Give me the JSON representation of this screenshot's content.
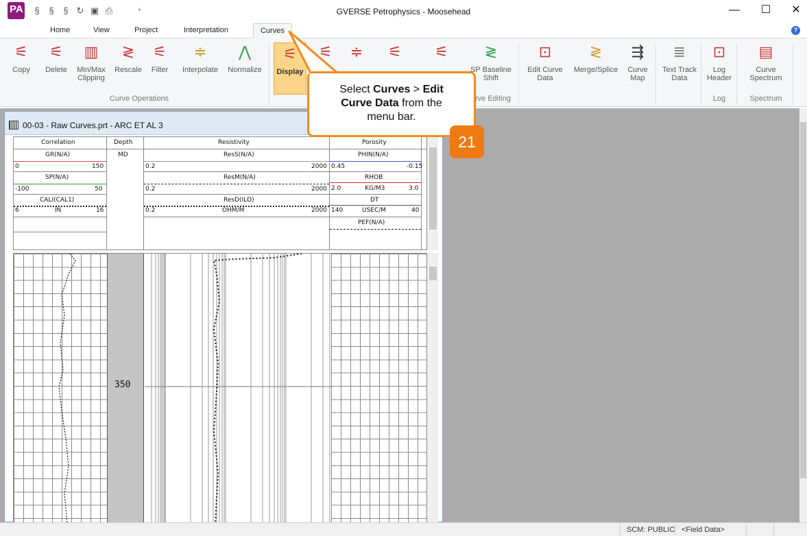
{
  "window": {
    "title": "GVERSE Petrophysics - Moosehead",
    "logo_text": "PA",
    "minimize": "—",
    "maximize": "☐",
    "close": "✕"
  },
  "quick_access": {
    "icons": [
      "curve-tool-icon",
      "curve-tool-icon",
      "curve-tool-icon",
      "refresh-icon",
      "save-icon",
      "print-icon"
    ],
    "dropdown": "⍖"
  },
  "tabs": [
    {
      "label": "Home"
    },
    {
      "label": "View"
    },
    {
      "label": "Project"
    },
    {
      "label": "Interpretation"
    },
    {
      "label": "Curves",
      "active": true
    }
  ],
  "ribbon": {
    "buttons": [
      {
        "label": "Copy",
        "icon": "copy-curve-icon"
      },
      {
        "label": "Delete",
        "icon": "delete-curve-icon"
      },
      {
        "label": "Min/Max Clipping",
        "label1": "Min/Max",
        "label2": "Clipping",
        "icon": "clipping-icon"
      },
      {
        "label": "Rescale",
        "icon": "rescale-icon"
      },
      {
        "label": "Filter",
        "icon": "filter-icon"
      },
      {
        "label": "Interpolate",
        "icon": "interpolate-icon"
      },
      {
        "label": "Normalize",
        "icon": "normalize-icon"
      },
      {
        "label": "Display",
        "icon": "display-icon",
        "active": true
      },
      {
        "label": "SP Baseline Shift",
        "label1": "SP Baseline",
        "label2": "Shift",
        "icon": "sp-baseline-icon"
      },
      {
        "label": "Edit Curve Data",
        "label1": "Edit Curve",
        "label2": "Data",
        "icon": "edit-curve-icon"
      },
      {
        "label": "Merge/Splice",
        "icon": "merge-splice-icon"
      },
      {
        "label": "Curve Map",
        "label1": "Curve",
        "label2": "Map",
        "icon": "curve-map-icon"
      },
      {
        "label": "Text Track Data",
        "label1": "Text Track",
        "label2": "Data",
        "icon": "text-track-icon"
      },
      {
        "label": "Log Header",
        "label1": "Log",
        "label2": "Header",
        "icon": "log-header-icon"
      },
      {
        "label": "Curve Spectrum",
        "label1": "Curve",
        "label2": "Spectrum",
        "icon": "curve-spectrum-icon"
      }
    ],
    "groups": {
      "curve_operations": "Curve Operations",
      "curve_editing": "rve Editing",
      "log": "Log",
      "spectrum": "Spectrum"
    }
  },
  "callout": {
    "text_pre": "Select ",
    "bold1": "Curves",
    "mid": " > ",
    "bold2": "Edit",
    "line2_bold": "Curve Data",
    "line2_rest": " from the",
    "line3": "menu bar.",
    "step": "21"
  },
  "document": {
    "title": "00-03 - Raw Curves.prt - ARC ET AL 3",
    "tracks": {
      "correlation": "Correlation",
      "depth": "Depth",
      "resistivity": "Resistivity",
      "porosity": "Porosity"
    },
    "depth_unit": "MD",
    "curves": {
      "gr": {
        "name": "GR(N/A)",
        "min": "0",
        "max": "150"
      },
      "sp": {
        "name": "SP(N/A)",
        "min": "-100",
        "max": "50"
      },
      "cal": {
        "name": "CALI(CAL1)",
        "unit": "IN",
        "min": "6",
        "max": "16"
      },
      "ress": {
        "name": "ResS(N/A)",
        "min": "0.2",
        "max": "2000"
      },
      "resm": {
        "name": "ResM(N/A)",
        "min": "0.2",
        "max": "2000"
      },
      "resd": {
        "name": "ResD(ILD)",
        "unit": "OHM/M",
        "min": "0.2",
        "max": "2000"
      },
      "phin": {
        "name": "PHIN(N/A)",
        "min": "0.45",
        "max": "-0.15"
      },
      "rhob": {
        "name": "RHOB",
        "unit": "KG/M3",
        "min": "2.0",
        "max": "3.0"
      },
      "dt": {
        "name": "DT",
        "unit": "USEC/M",
        "min": "140",
        "max": "40"
      },
      "pef": {
        "name": "PEF(N/A)"
      }
    },
    "depth_marker": "350"
  },
  "status": {
    "scm": "SCM: PUBLIC",
    "field": "<Field Data>"
  },
  "colors": {
    "callout_border": "#f28a1e",
    "badge": "#f07a12",
    "active_button": "#fbd68a",
    "gr_line": "#e04848",
    "sp_line": "#2b9a2b",
    "phin_line": "#3b5fd6",
    "rhob_line": "#d93030"
  }
}
